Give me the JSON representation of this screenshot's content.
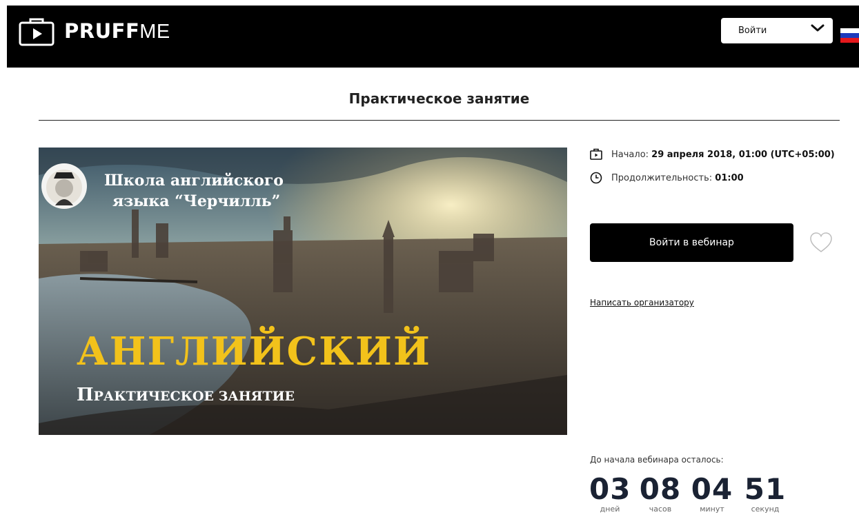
{
  "header": {
    "logo_bold": "PRUFF",
    "logo_light": "ME",
    "login_label": "Войти",
    "flag": {
      "colors": [
        "#ffffff",
        "#1c39bb",
        "#e4181c"
      ]
    }
  },
  "page_title": "Практическое занятие",
  "banner": {
    "school_line1": "Школа английского",
    "school_line2": "языка “Черчилль”",
    "big_title": "АНГЛИЙСКИЙ",
    "subtitle_first": "П",
    "subtitle_rest": "рактическое занятие",
    "title_color": "#f2c21b"
  },
  "info": {
    "start_label": "Начало:",
    "start_value": "29 апреля 2018, 01:00 (UTC+05:00)",
    "duration_label": "Продолжительность:",
    "duration_value": "01:00"
  },
  "actions": {
    "join_label": "Войти в вебинар",
    "contact_label": "Написать организатору"
  },
  "countdown": {
    "label": "До начала вебинара осталось:",
    "days": "03",
    "days_label": "дней",
    "hours": "08",
    "hours_label": "часов",
    "minutes": "04",
    "minutes_label": "минут",
    "seconds": "51",
    "seconds_label": "секунд"
  }
}
